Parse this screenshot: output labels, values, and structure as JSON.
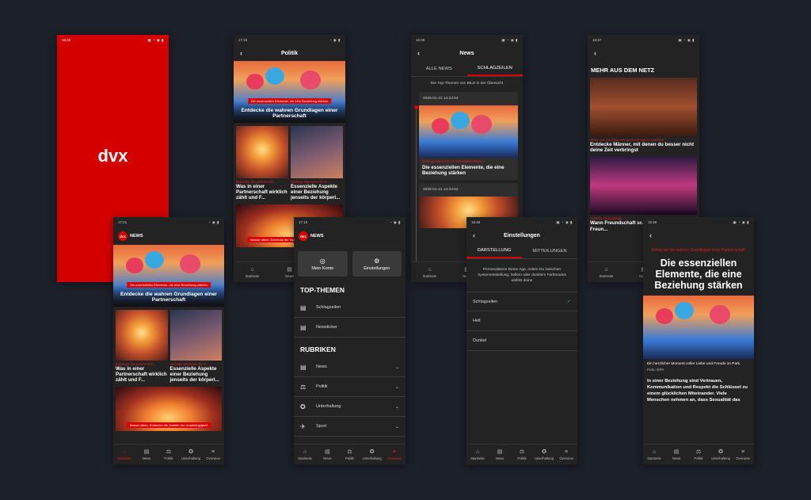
{
  "splash": {
    "time": "16:46",
    "logo": "dvx"
  },
  "home": {
    "time": "17:21",
    "brand_badge": "dvx",
    "brand": "NEWS",
    "hero": {
      "kicker": "Die essenziellen Elemente, die eine Beziehung stärken",
      "title": "Entdecke die wahren Grundlagen einer Partnerschaft"
    },
    "items": [
      {
        "kicker": "Entdecke die wahren Sch...",
        "title": "Was in einer Partnerschaft wirklich zählt und F..."
      },
      {
        "kicker": "Wichtige Elemente für ei...",
        "title": "Essenzielle Aspekte einer Beziehung jenseits der körperl..."
      }
    ],
    "bottom_kicker": "Besser allein: Entdecke die Vorteile der Unabhängigkeit"
  },
  "nav": {
    "items": [
      {
        "icon": "⌂",
        "label": "Startseite"
      },
      {
        "icon": "▤",
        "label": "News"
      },
      {
        "icon": "⚖",
        "label": "Politik"
      },
      {
        "icon": "✪",
        "label": "Unterhaltung"
      },
      {
        "icon": "≡",
        "label": "Overview"
      }
    ]
  },
  "politik": {
    "time": "17:15",
    "title": "Politik",
    "hero": {
      "kicker": "Die essenziellen Elemente, die eine Beziehung stärken",
      "title": "Entdecke die wahren Grundlagen einer Partnerschaft"
    },
    "items": [
      {
        "kicker": "Entdecke die wahren Sch...",
        "title": "Was in einer Partnerschaft wirklich zählt und F..."
      },
      {
        "kicker": "Wichtige Elemente für ei...",
        "title": "Essenzielle Aspekte einer Beziehung jenseits der körperl..."
      }
    ],
    "bottom_kicker": "Besser allein: Entdecke die Vorteile der Unabhängigkeit"
  },
  "overview": {
    "time": "17:15",
    "brand_badge": "dvx",
    "brand": "NEWS",
    "account": "Mein Konto",
    "settings": "Einstellungen",
    "top_heading": "TOP-THEMEN",
    "top_items": [
      "Schlagzeilen",
      "Newsticker"
    ],
    "rub_heading": "RUBRIKEN",
    "rub_items": [
      "News",
      "Politik",
      "Unterhaltung",
      "Sport"
    ]
  },
  "news": {
    "time": "16:46",
    "title": "News",
    "tab_all": "ALLE NEWS",
    "tab_head": "SCHLAGZEILEN",
    "intro": "Die Top-Themen von BILD in der Übersicht",
    "card1": {
      "date": "2025-01-21 14:34:54",
      "kicker": "Wichtige Elemente für eine stabile Bezie...",
      "title": "Die essenziellen Elemente, die eine Beziehung stärken"
    },
    "card2": {
      "date": "2025-01-21 14:34:52"
    }
  },
  "settings": {
    "time": "16:46",
    "title": "Einstellungen",
    "tab1": "DARSTELLUNG",
    "tab2": "MITTEILUNGEN",
    "desc": "Personalisiere Deine App, indem Du zwischen Systemeinstellung, hellem oder dunklem Farbmodus wählst deine",
    "options": [
      "Schlagzeilen",
      "Hell",
      "Dunkel"
    ]
  },
  "more": {
    "time": "16:47",
    "heading": "MEHR AUS DEM NETZ",
    "a1": {
      "kicker": "Zeine, wie du deine Zeit gewinnbringend ausübest",
      "title": "Entdecke Männer, mit denen du besser nicht deine Zeit verbringst"
    },
    "a2": {
      "kicker": "Vorsicht vor bösartige ...",
      "title": "Wann Freundschaft sc... Arten toxischer Freun..."
    }
  },
  "article": {
    "time": "16:46",
    "kicker": "Entdecke die wahren Grundlagen einer Partnerschaft",
    "headline": "Die essenziellen Elemente, die eine Beziehung stärken",
    "caption": "Ein herzlicher Moment voller Liebe und Freude im Park.",
    "credit": "Foto: EPA",
    "body": "In einer Beziehung sind Vertrauen, Kommunikation und Respekt die Schlüssel zu einem glücklichen Miteinander. Viele Menschen nehmen an, dass Sexualität das"
  },
  "colors": {
    "accent": "#dd0000",
    "bg": "#1c2028",
    "phone": "#232323"
  }
}
